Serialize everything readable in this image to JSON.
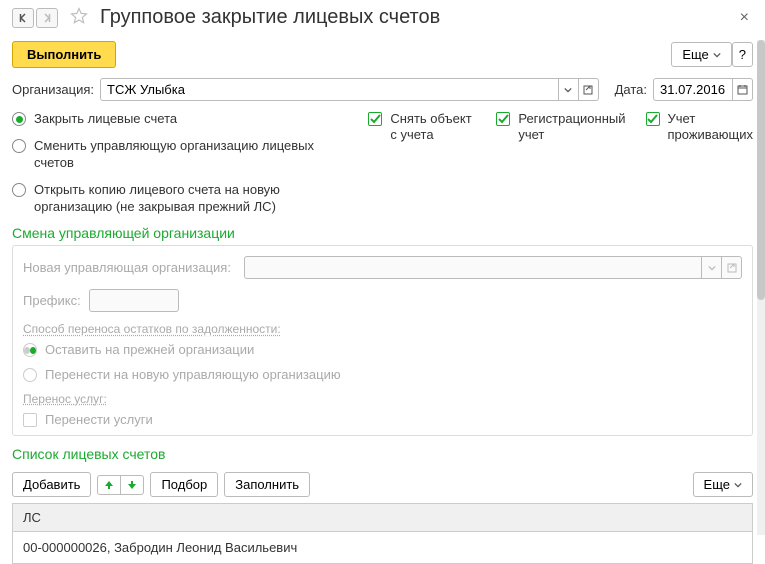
{
  "header": {
    "title": "Групповое закрытие лицевых счетов"
  },
  "toolbar": {
    "execute": "Выполнить",
    "more": "Еще",
    "help": "?"
  },
  "org": {
    "label": "Организация:",
    "value": "ТСЖ Улыбка"
  },
  "date": {
    "label": "Дата:",
    "value": "31.07.2016"
  },
  "radios": {
    "r1": "Закрыть лицевые счета",
    "r2": "Сменить управляющую организацию лицевых счетов",
    "r3": "Открыть копию лицевого счета на новую организацию (не закрывая прежний ЛС)"
  },
  "checks": {
    "c1": "Снять объект с учета",
    "c2": "Регистрационный учет",
    "c3": "Учет проживающих"
  },
  "change_org": {
    "title": "Смена управляющей организации",
    "new_org_label": "Новая управляющая организация:",
    "new_org_value": "",
    "prefix_label": "Префикс:",
    "prefix_value": "",
    "debt_hdr": "Способ переноса остатков по задолженности:",
    "debt_r1": "Оставить на прежней организации",
    "debt_r2": "Перенести на новую управляющую организацию",
    "svc_hdr": "Перенос услуг:",
    "svc_chk": "Перенести услуги"
  },
  "list": {
    "title": "Список лицевых счетов",
    "add": "Добавить",
    "pick": "Подбор",
    "fill": "Заполнить",
    "more": "Еще",
    "col_ls": "ЛС",
    "row1": "00-000000026, Забродин Леонид Васильевич"
  }
}
